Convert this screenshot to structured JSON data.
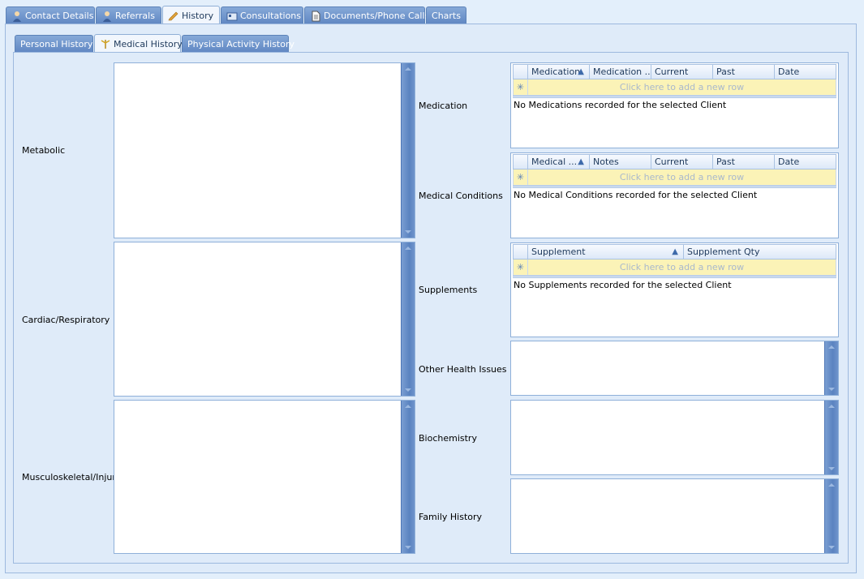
{
  "main_tabs": [
    {
      "label": "Contact Details",
      "icon": "person-icon"
    },
    {
      "label": "Referrals",
      "icon": "person-icon"
    },
    {
      "label": "History",
      "icon": "pencil-icon",
      "active": true
    },
    {
      "label": "Consultations",
      "icon": "card-icon"
    },
    {
      "label": "Documents/Phone Calls",
      "icon": "document-icon"
    },
    {
      "label": "Charts",
      "icon": ""
    }
  ],
  "sub_tabs": [
    {
      "label": "Personal History"
    },
    {
      "label": "Medical History",
      "icon": "caduceus-icon",
      "active": true
    },
    {
      "label": "Physical Activity History"
    }
  ],
  "left_labels": {
    "metabolic": "Metabolic",
    "cardiac": "Cardiac/Respiratory",
    "musculoskeletal": "Musculoskeletal/Injury"
  },
  "right_labels": {
    "medication": "Medication",
    "medical_conditions": "Medical Conditions",
    "supplements": "Supplements",
    "other_health": "Other Health Issues",
    "biochemistry": "Biochemistry",
    "family_history": "Family History"
  },
  "grids": {
    "medication": {
      "columns": [
        "Medication",
        "Medication ...",
        "Current",
        "Past",
        "Date"
      ],
      "sorted_column": 0,
      "new_row_text": "Click here to add a new row",
      "empty_text": "No Medications recorded for the selected Client"
    },
    "medical_conditions": {
      "columns": [
        "Medical ...",
        "Notes",
        "Current",
        "Past",
        "Date"
      ],
      "sorted_column": 0,
      "new_row_text": "Click here to add a new row",
      "empty_text": "No Medical Conditions recorded for the selected Client"
    },
    "supplements": {
      "columns": [
        "Supplement",
        "Supplement Qty"
      ],
      "sorted_column": 0,
      "new_row_text": "Click here to add a new row",
      "empty_text": "No Supplements recorded for the selected Client"
    }
  },
  "new_row_glyph": "✳",
  "sort_glyph": "▲",
  "colors": {
    "background": "#e3effb",
    "tab_inactive": "#6a90c8",
    "new_row": "#fbf3b7",
    "scrollbar": "#5f87c3"
  }
}
